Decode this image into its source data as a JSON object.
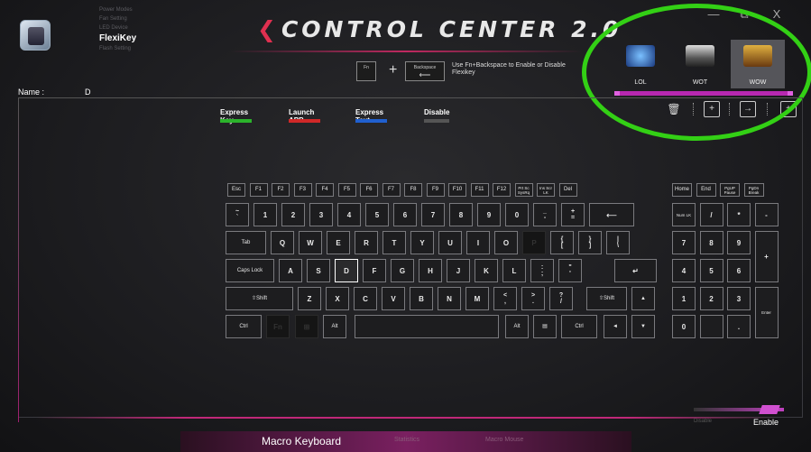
{
  "app": {
    "title": "CONTROL CENTER 2.0"
  },
  "nav": {
    "items": [
      "Power Modes",
      "Fan Setting",
      "LED Device",
      "FlexiKey",
      "Flash Setting"
    ],
    "active": "FlexiKey"
  },
  "name_field": {
    "label": "Name :",
    "value": "D"
  },
  "window_controls": {
    "minimize": "—",
    "restore": "⧉",
    "close": "X"
  },
  "hint": {
    "fn_key": "Fn",
    "plus": "+",
    "backspace_key": "Backspace",
    "text": "Use Fn+Backspace to Enable or Disable Flexikey"
  },
  "profiles": [
    {
      "label": "LOL",
      "color": "#2a5fb0"
    },
    {
      "label": "WOT",
      "color": "#8a8a7a"
    },
    {
      "label": "WOW",
      "color": "#6a4a20",
      "selected": true
    }
  ],
  "profile_tools": {
    "delete": "🗑",
    "add": "+",
    "export": "→",
    "import": "+"
  },
  "tabs": [
    {
      "label": "Express Key",
      "color": "#2bb32b"
    },
    {
      "label": "Launch APP",
      "color": "#d02828"
    },
    {
      "label": "Express Text",
      "color": "#2060d0"
    },
    {
      "label": "Disable",
      "color": "#555555"
    }
  ],
  "keyboard": {
    "fn_row": [
      "Esc",
      "F1",
      "F2",
      "F3",
      "F4",
      "F5",
      "F6",
      "F7",
      "F8",
      "F9",
      "F10",
      "F11",
      "F12",
      "Prt Sc SysRq",
      "Ins Scr LK",
      "Del"
    ],
    "num_row": [
      [
        "~",
        "`"
      ],
      [
        "",
        "1"
      ],
      [
        "",
        "2"
      ],
      [
        "",
        "3"
      ],
      [
        "",
        "4"
      ],
      [
        "",
        "5"
      ],
      [
        "",
        "6"
      ],
      [
        "",
        "7"
      ],
      [
        "",
        "8"
      ],
      [
        "",
        "9"
      ],
      [
        "",
        "0"
      ],
      [
        "_",
        "-"
      ],
      [
        "+",
        "="
      ],
      [
        "",
        "⟵"
      ]
    ],
    "q_row": [
      "Tab",
      "Q",
      "W",
      "E",
      "R",
      "T",
      "Y",
      "U",
      "I",
      "O",
      "P",
      [
        "{",
        "["
      ],
      [
        "}",
        "]"
      ],
      [
        "|",
        "\\"
      ]
    ],
    "a_row": [
      "Caps Lock",
      "A",
      "S",
      "D",
      "F",
      "G",
      "H",
      "J",
      "K",
      "L",
      [
        ":",
        ";"
      ],
      [
        "\"",
        "'"
      ],
      "↵"
    ],
    "z_row": [
      "⇧Shift",
      "Z",
      "X",
      "C",
      "V",
      "B",
      "N",
      "M",
      [
        "<",
        ","
      ],
      [
        ">",
        "."
      ],
      [
        "?",
        "/"
      ],
      "⇧Shift",
      "▲"
    ],
    "ctrl_row": [
      "Ctrl",
      "Fn",
      "⊞",
      "Alt",
      "",
      "Alt",
      "▤",
      "Ctrl",
      "◄",
      "▼",
      "►"
    ],
    "nav_cluster": [
      "Home",
      "End",
      "PgUP Pause",
      "PgDn Break"
    ],
    "numpad": [
      "Num LK",
      "/",
      "*",
      "-",
      "7",
      "8",
      "9",
      "+",
      "4",
      "5",
      "6",
      "1",
      "2",
      "3",
      "Enter",
      "0",
      "."
    ],
    "selected_key": "D"
  },
  "toggle": {
    "off_label": "Disable",
    "on_label": "Enable",
    "state": "Enable"
  },
  "bottom_tabs": [
    {
      "label": "Macro Keyboard",
      "active": true
    },
    {
      "label": "Statistics",
      "active": false
    },
    {
      "label": "Macro Mouse",
      "active": false
    }
  ],
  "colors": {
    "accent": "#c02878",
    "highlight_ring": "#33d015"
  }
}
